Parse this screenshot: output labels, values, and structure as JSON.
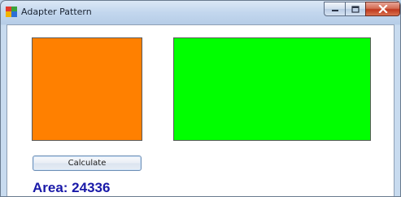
{
  "window": {
    "title": "Adapter Pattern",
    "app_icon": "colorful-app-icon",
    "controls": {
      "minimize_icon": "minimize-icon",
      "maximize_icon": "maximize-icon",
      "close_icon": "close-icon"
    }
  },
  "shapes": {
    "square_color": "#ff8000",
    "rectangle_color": "#00ff00"
  },
  "actions": {
    "calculate_label": "Calculate"
  },
  "result": {
    "area_text": "Area: 24336",
    "color": "#1919a8"
  }
}
